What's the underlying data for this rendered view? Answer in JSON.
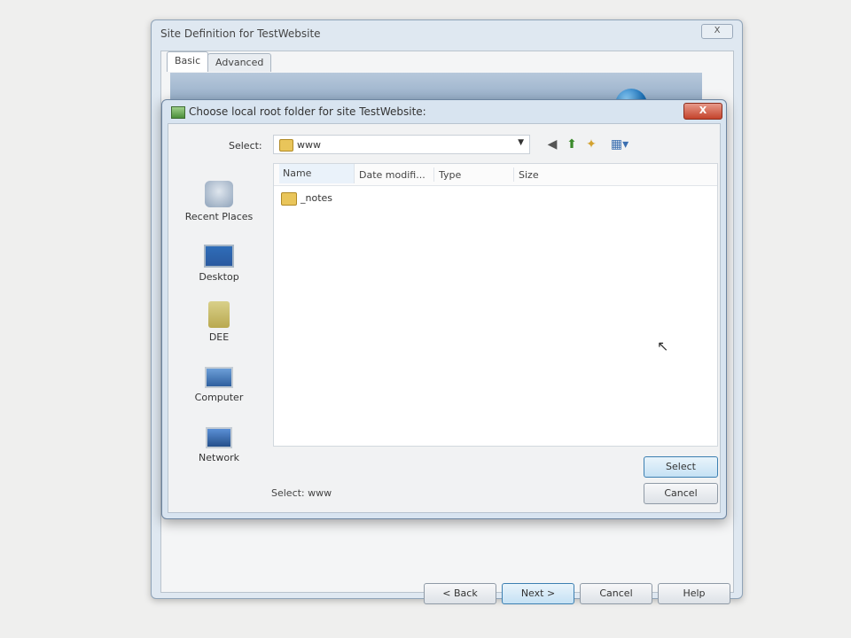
{
  "background_window": {
    "title": "Site Definition for TestWebsite",
    "close_label": "X",
    "tabs": [
      "Basic",
      "Advanced"
    ],
    "buttons": {
      "back": "< Back",
      "next": "Next >",
      "cancel": "Cancel",
      "help": "Help"
    }
  },
  "dialog": {
    "title": "Choose local root folder for site TestWebsite:",
    "close_label": "X",
    "select_label": "Select:",
    "location": {
      "value": "www",
      "icon": "folder-icon"
    },
    "toolbar_icons": [
      "back-icon",
      "up-folder-icon",
      "new-folder-icon",
      "views-menu-icon"
    ],
    "places": [
      {
        "label": "Recent Places",
        "icon": "recent-places-icon"
      },
      {
        "label": "Desktop",
        "icon": "desktop-icon"
      },
      {
        "label": "DEE",
        "icon": "user-folder-icon"
      },
      {
        "label": "Computer",
        "icon": "computer-icon"
      },
      {
        "label": "Network",
        "icon": "network-icon"
      }
    ],
    "columns": [
      "Name",
      "Date modifi...",
      "Type",
      "Size"
    ],
    "files": [
      {
        "name": "_notes",
        "icon": "folder-icon"
      }
    ],
    "status_text": "Select: www",
    "select_button": "Select",
    "cancel_button": "Cancel"
  }
}
